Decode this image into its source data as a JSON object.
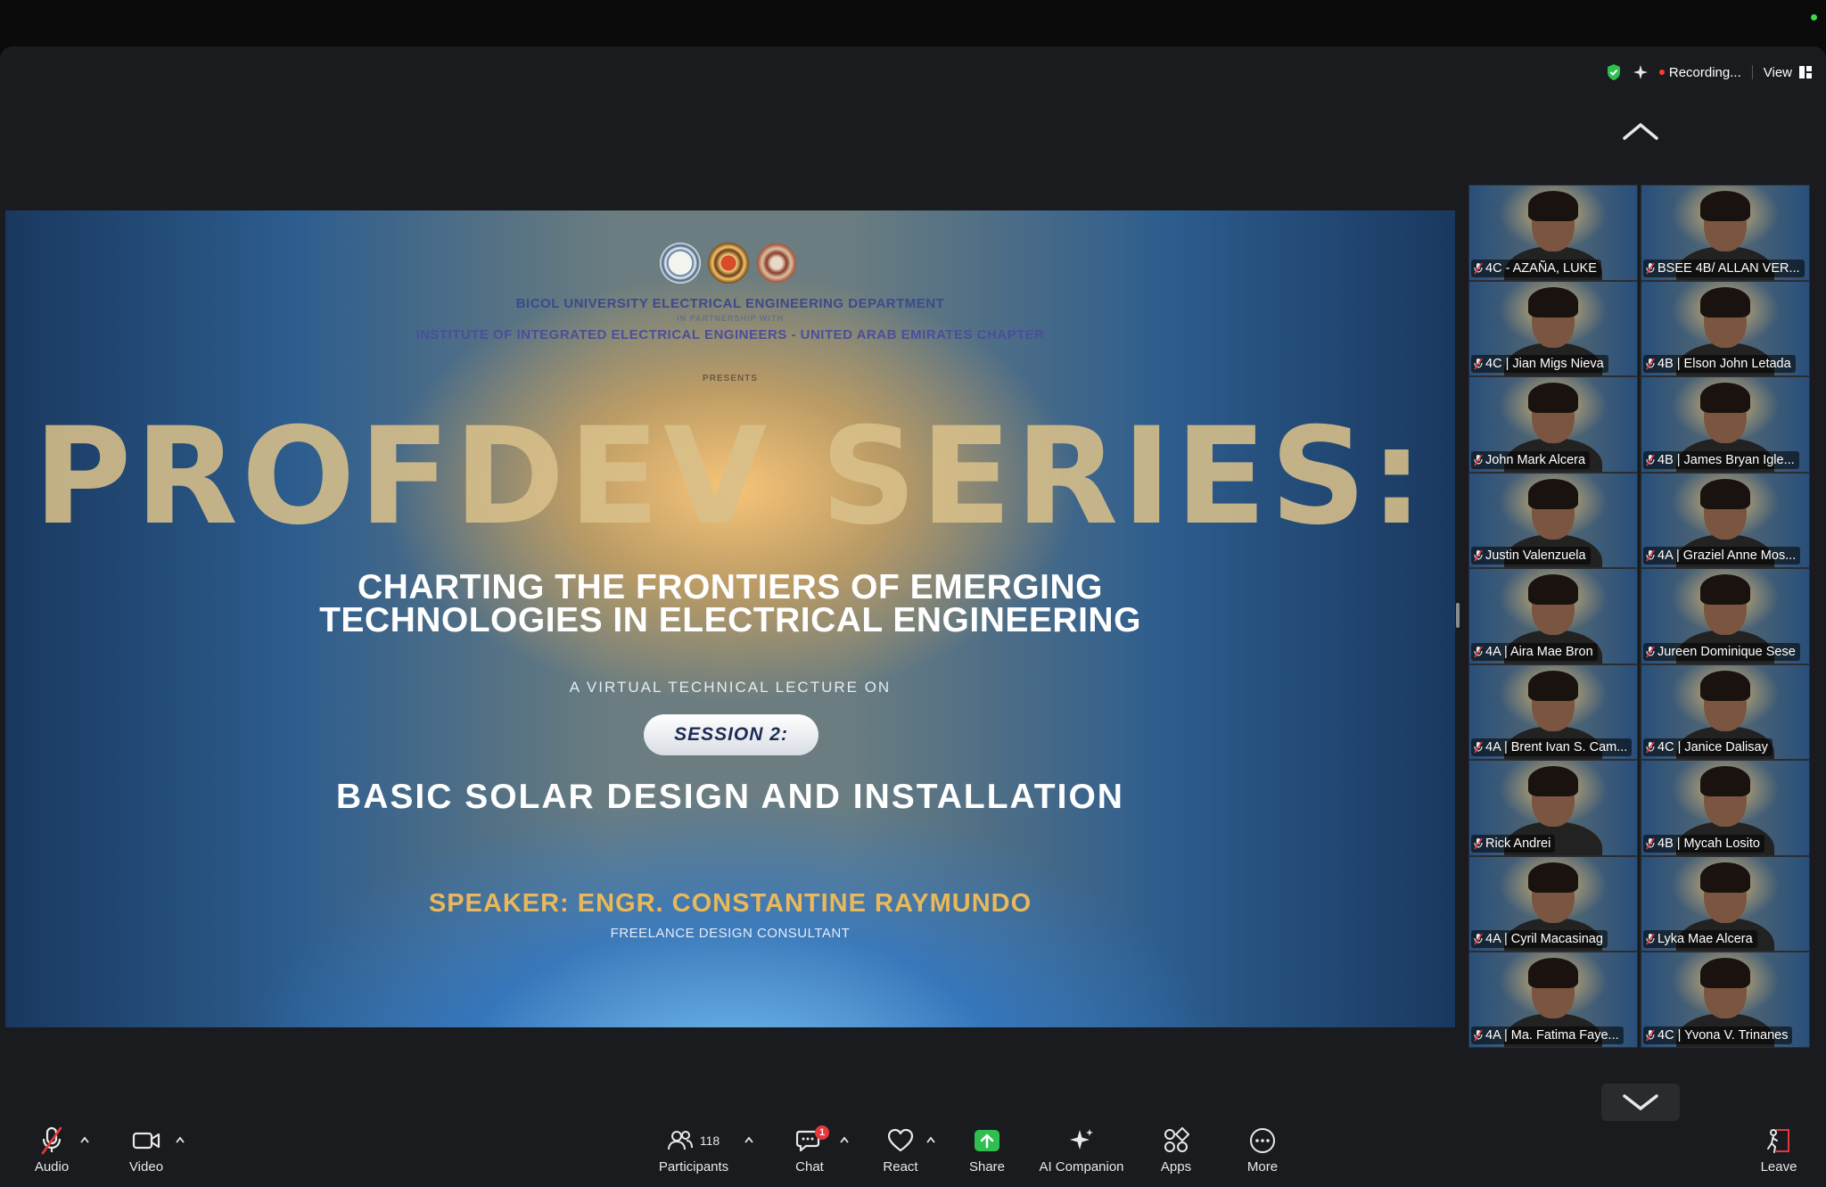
{
  "top": {
    "status_dot_color": "#3ddc4a"
  },
  "status": {
    "recording": "Recording...",
    "view": "View"
  },
  "slide": {
    "dept": "BICOL UNIVERSITY ELECTRICAL ENGINEERING DEPARTMENT",
    "partner": "IN PARTNERSHIP WITH",
    "institute": "INSTITUTE OF INTEGRATED ELECTRICAL ENGINEERS - UNITED ARAB EMIRATES CHAPTER",
    "presents": "PRESENTS",
    "series": "PROFDEV SERIES:",
    "title_line1": "CHARTING THE FRONTIERS OF EMERGING",
    "title_line2": "TECHNOLOGIES IN ELECTRICAL ENGINEERING",
    "virtual": "A VIRTUAL TECHNICAL LECTURE ON",
    "session": "SESSION 2:",
    "topic": "BASIC SOLAR DESIGN AND INSTALLATION",
    "speaker": "SPEAKER:  ENGR. CONSTANTINE RAYMUNDO",
    "speaker_role": "FREELANCE DESIGN CONSULTANT"
  },
  "participants": [
    {
      "name": "4C - AZAÑA, LUKE"
    },
    {
      "name": "BSEE 4B/ ALLAN VER..."
    },
    {
      "name": "4C | Jian Migs Nieva"
    },
    {
      "name": "4B | Elson John Letada"
    },
    {
      "name": "John Mark Alcera"
    },
    {
      "name": "4B | James Bryan Igle..."
    },
    {
      "name": "Justin Valenzuela"
    },
    {
      "name": "4A | Graziel Anne Mos..."
    },
    {
      "name": "4A | Aira Mae Bron"
    },
    {
      "name": "Jureen Dominique Sese"
    },
    {
      "name": "4A | Brent Ivan S. Cam..."
    },
    {
      "name": "4C | Janice Dalisay"
    },
    {
      "name": "Rick Andrei"
    },
    {
      "name": "4B | Mycah Losito"
    },
    {
      "name": "4A | Cyril Macasinag"
    },
    {
      "name": "Lyka Mae Alcera"
    },
    {
      "name": "4A | Ma. Fatima Faye..."
    },
    {
      "name": "4C | Yvona V. Trinanes"
    }
  ],
  "toolbar": {
    "audio": "Audio",
    "video": "Video",
    "participants": "Participants",
    "participants_count": "118",
    "chat": "Chat",
    "chat_badge": "1",
    "react": "React",
    "share": "Share",
    "ai_companion": "AI Companion",
    "apps": "Apps",
    "more": "More",
    "leave": "Leave"
  }
}
